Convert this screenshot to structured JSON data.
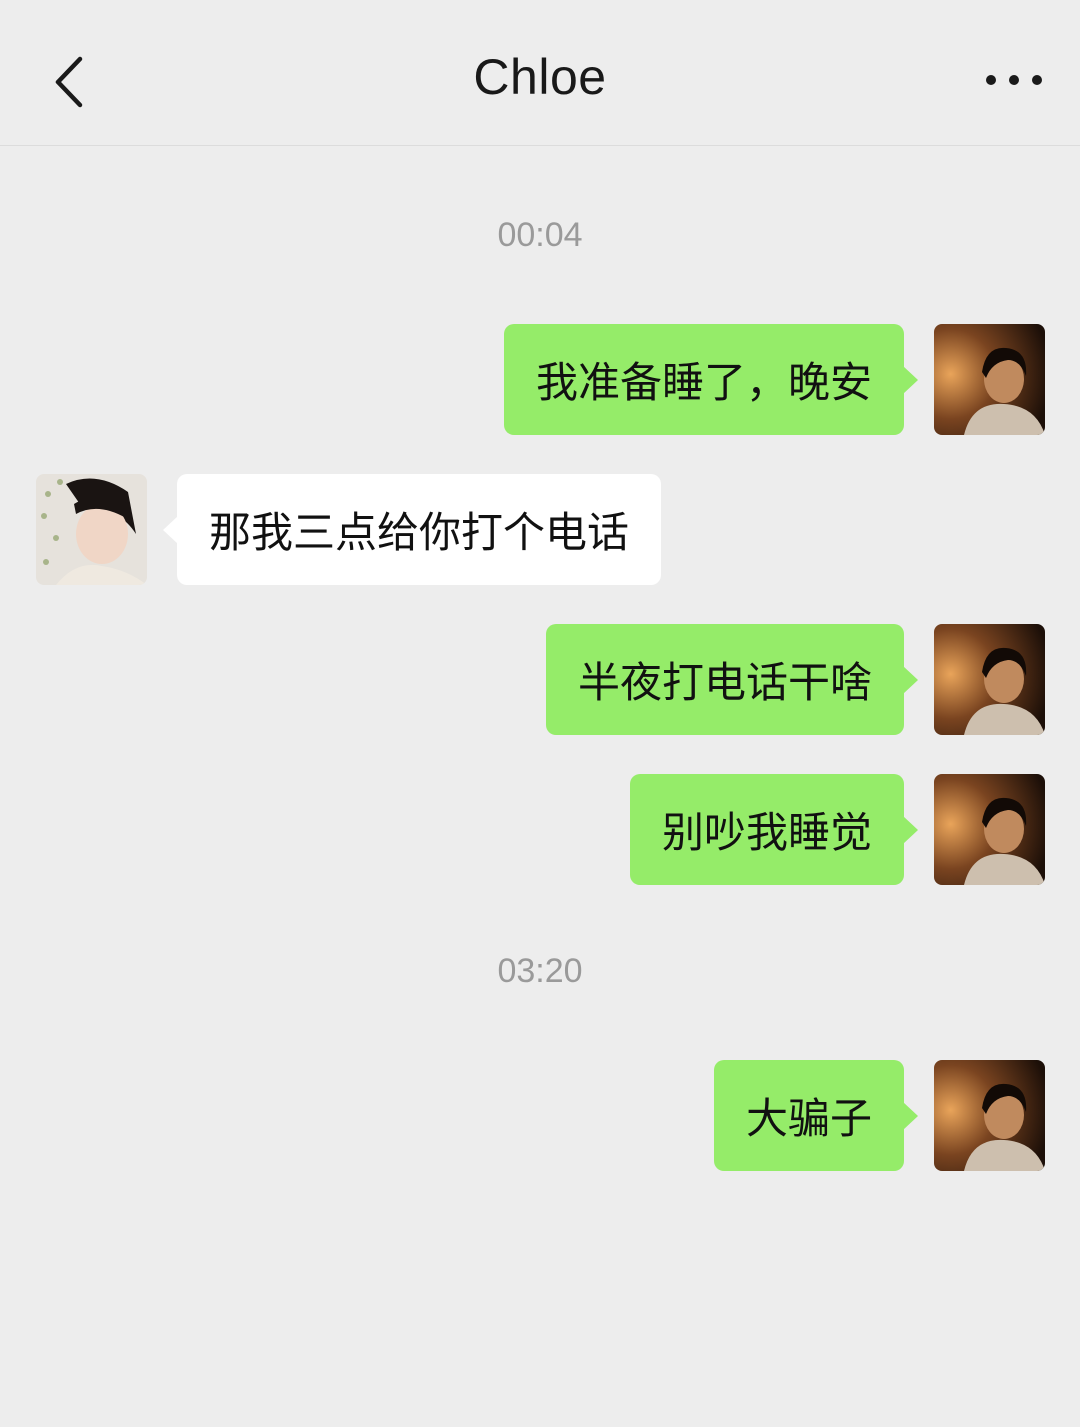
{
  "header": {
    "title": "Chloe",
    "back_icon": "chevron-left-icon",
    "more_icon": "more-dots-icon"
  },
  "messages": {
    "time1": "00:04",
    "m1": "我准备睡了，晚安",
    "m2": "那我三点给你打个电话",
    "m3": "半夜打电话干啥",
    "m4": "别吵我睡觉",
    "time2": "03:20",
    "m5": "大骗子"
  },
  "colors": {
    "background": "#ededed",
    "outgoing_bubble": "#95ec69",
    "incoming_bubble": "#ffffff",
    "timestamp_text": "#9a9a9a"
  }
}
